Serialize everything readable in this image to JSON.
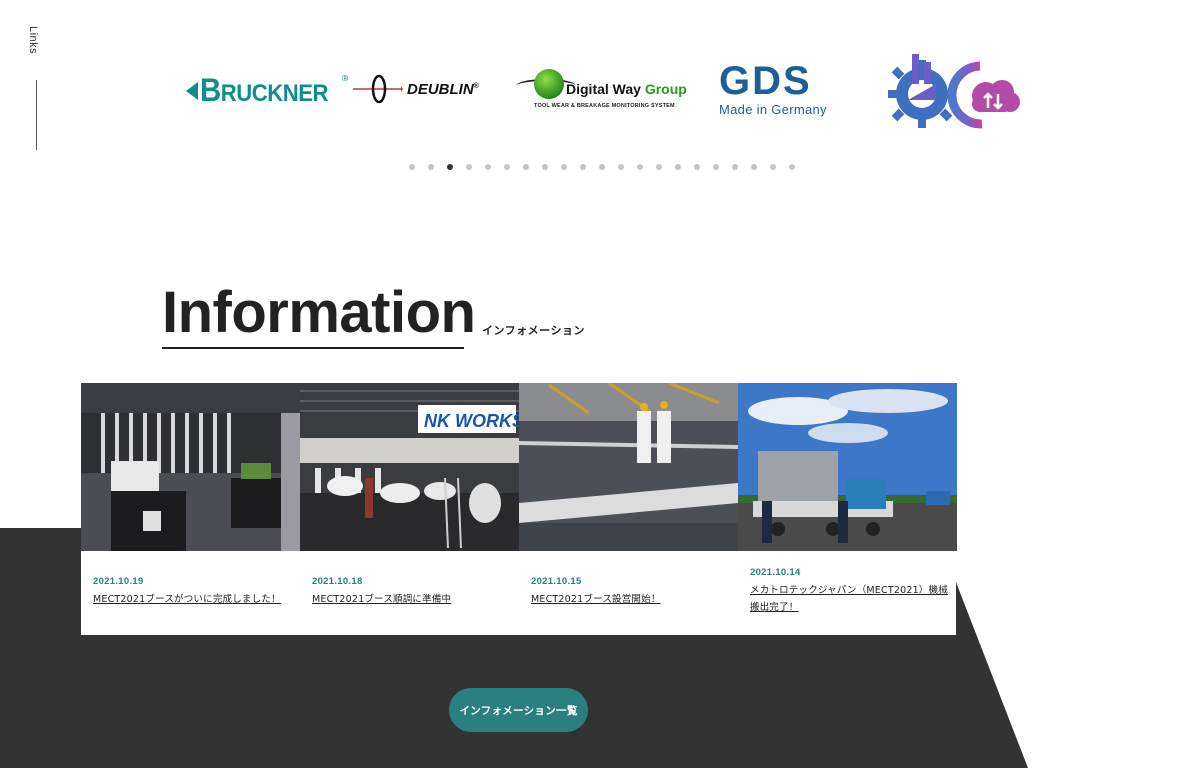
{
  "sidebar": {
    "label": "Links"
  },
  "logos": {
    "bruckner": {
      "big_letter": "B",
      "rest": "RUCKNER",
      "reg": "®",
      "color": "#0e8e8c"
    },
    "deublin": {
      "name": "DEUBLIN",
      "reg": "®"
    },
    "digitalway": {
      "name_main": "Digital Way ",
      "name_accent": "Group",
      "tagline": "TOOL WEAR & BREAKAGE MONITORING SYSTEM"
    },
    "gds": {
      "name": "GDS",
      "tagline": "Made in Germany",
      "color": "#1f5f98"
    },
    "cloud": {
      "icon": "factory-gear-cloud-icon"
    }
  },
  "carousel": {
    "dot_count": 21,
    "active_index": 2
  },
  "information": {
    "title": "Information",
    "subtitle": "インフォメーション",
    "cards": [
      {
        "date": "2021.10.19",
        "title": "MECT2021ブースがついに完成しました！"
      },
      {
        "date": "2021.10.18",
        "title": "MECT2021ブース順調に準備中"
      },
      {
        "date": "2021.10.15",
        "title": "MECT2021ブース設営開始！"
      },
      {
        "date": "2021.10.14",
        "title": "メカトロテックジャパン（MECT2021）機械搬出完了！"
      }
    ],
    "list_button": "インフォメーション一覧"
  },
  "colors": {
    "accent": "#2a7f80",
    "dark": "#333333"
  }
}
